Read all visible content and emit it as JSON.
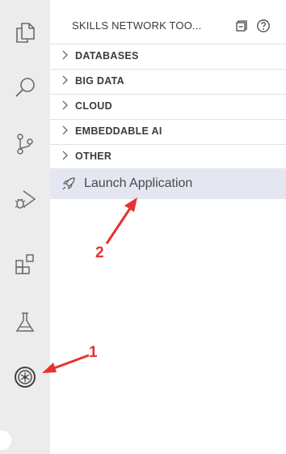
{
  "activity_bar": {
    "icons": [
      "explorer-icon",
      "search-icon",
      "source-control-icon",
      "run-debug-icon",
      "extensions-icon",
      "testing-icon",
      "skills-network-icon"
    ]
  },
  "sidebar": {
    "title": "SKILLS NETWORK TOO...",
    "sections": [
      {
        "label": "DATABASES"
      },
      {
        "label": "BIG DATA"
      },
      {
        "label": "CLOUD"
      },
      {
        "label": "EMBEDDABLE AI"
      },
      {
        "label": "OTHER"
      }
    ],
    "launch_label": "Launch Application"
  },
  "annotations": {
    "one": "1",
    "two": "2",
    "color": "#e8312f"
  }
}
